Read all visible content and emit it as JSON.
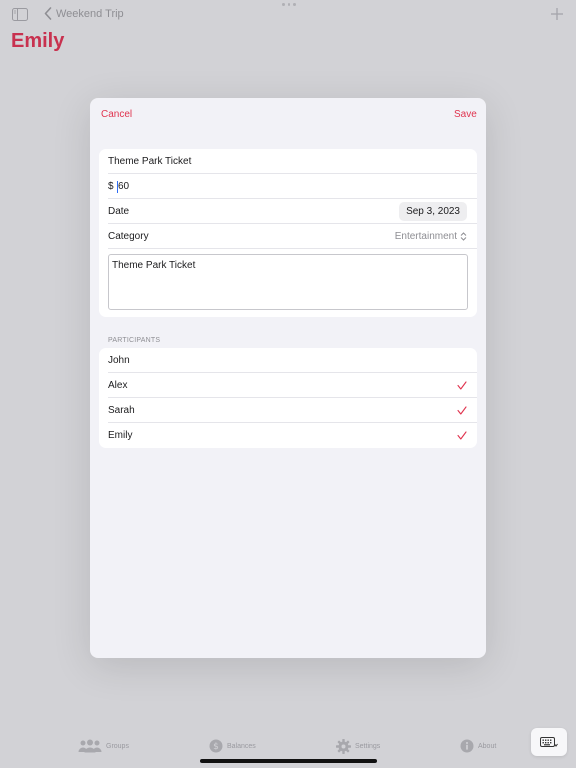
{
  "header": {
    "back_label": "Weekend Trip",
    "title": "Emily"
  },
  "modal": {
    "cancel_label": "Cancel",
    "save_label": "Save",
    "expense_name": "Theme Park Ticket",
    "currency_symbol": "$",
    "amount": "60",
    "date_label": "Date",
    "date_value": "Sep 3, 2023",
    "category_label": "Category",
    "category_value": "Entertainment",
    "notes": "Theme Park Ticket"
  },
  "participants": {
    "header": "PARTICIPANTS",
    "items": [
      {
        "name": "John",
        "checked": false
      },
      {
        "name": "Alex",
        "checked": true
      },
      {
        "name": "Sarah",
        "checked": true
      },
      {
        "name": "Emily",
        "checked": true
      }
    ]
  },
  "tab_bar": {
    "tabs": [
      {
        "label": "Groups",
        "icon": "groups-icon"
      },
      {
        "label": "Balances",
        "icon": "dollar-icon"
      },
      {
        "label": "Settings",
        "icon": "gear-icon"
      },
      {
        "label": "About",
        "icon": "info-icon"
      }
    ]
  },
  "colors": {
    "accent": "#e0344f",
    "title": "#c8314f",
    "background": "#d2d2d6",
    "sheet": "#f2f2f7"
  }
}
